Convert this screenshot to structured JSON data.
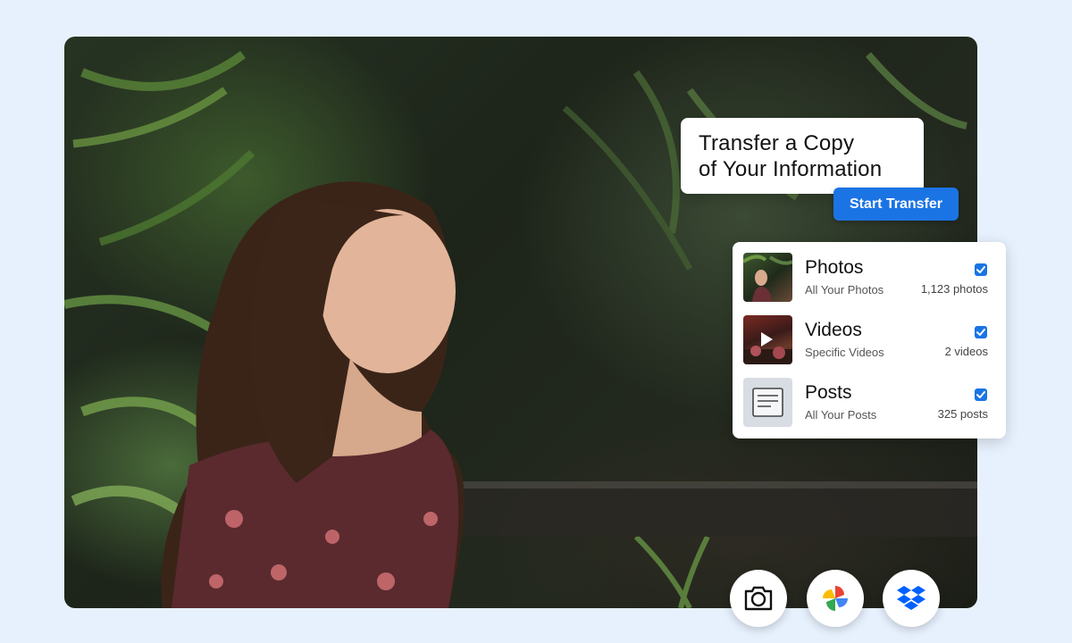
{
  "transfer_card": {
    "title_line1": "Transfer a Copy",
    "title_line2": "of Your Information",
    "button_label": "Start Transfer"
  },
  "items": [
    {
      "name": "Photos",
      "subtitle": "All Your Photos",
      "count": "1,123 photos",
      "checked": true,
      "thumb": "photo-thumbnail"
    },
    {
      "name": "Videos",
      "subtitle": "Specific Videos",
      "count": "2 videos",
      "checked": true,
      "thumb": "video-thumbnail"
    },
    {
      "name": "Posts",
      "subtitle": "All Your Posts",
      "count": "325 posts",
      "checked": true,
      "thumb": "document-icon"
    }
  ],
  "destinations": [
    {
      "icon": "camera-icon"
    },
    {
      "icon": "pinwheel-icon"
    },
    {
      "icon": "dropbox-icon"
    }
  ],
  "colors": {
    "page_background": "#e7f1fd",
    "accent": "#1b74e4",
    "card_background": "#ffffff"
  }
}
